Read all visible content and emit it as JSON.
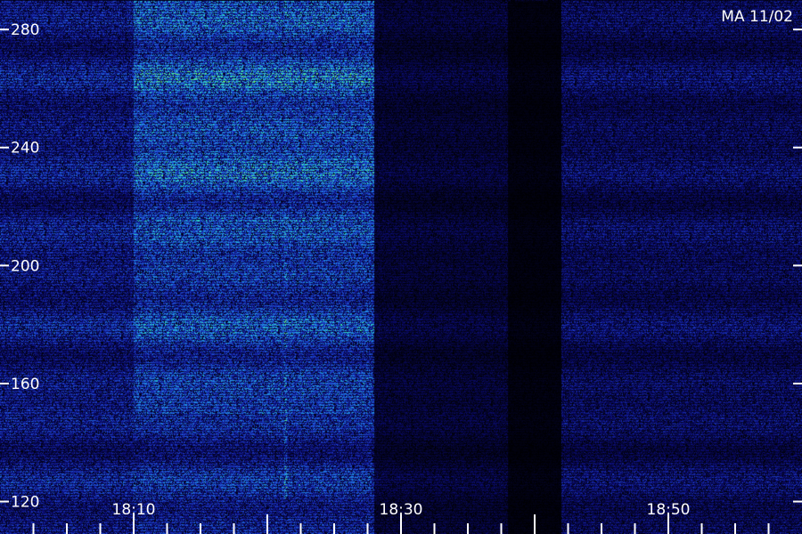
{
  "chart_data": {
    "type": "heatmap",
    "title": "",
    "corner_label": "MA 11/02",
    "xlabel": "",
    "ylabel": "",
    "x_ticks": [
      {
        "label": "18:10",
        "minutes": 10
      },
      {
        "label": "18:30",
        "minutes": 30
      },
      {
        "label": "18:50",
        "minutes": 50
      }
    ],
    "y_ticks": [
      {
        "label": "280",
        "value": 280
      },
      {
        "label": "240",
        "value": 240
      },
      {
        "label": "200",
        "value": 200
      },
      {
        "label": "160",
        "value": 160
      },
      {
        "label": "120",
        "value": 120
      }
    ],
    "xlim_minutes": [
      0,
      60
    ],
    "ylim": [
      109,
      290
    ],
    "colormap": [
      "#000000",
      "#0a0a6e",
      "#1e3fcf",
      "#1f8fe6",
      "#2fe0c8",
      "#8cff3a"
    ],
    "intensity_regions": [
      {
        "t_start": 0,
        "t_end": 10,
        "v_low": 109,
        "v_high": 290,
        "level": 0.42
      },
      {
        "t_start": 10,
        "t_end": 28,
        "v_low": 109,
        "v_high": 150,
        "level": 0.5
      },
      {
        "t_start": 10,
        "t_end": 28,
        "v_low": 150,
        "v_high": 215,
        "level": 0.62
      },
      {
        "t_start": 10,
        "t_end": 28,
        "v_low": 215,
        "v_high": 290,
        "level": 0.72
      },
      {
        "t_start": 28,
        "t_end": 38,
        "v_low": 109,
        "v_high": 290,
        "level": 0.18
      },
      {
        "t_start": 38,
        "t_end": 42,
        "v_low": 109,
        "v_high": 290,
        "level": 0.05
      },
      {
        "t_start": 42,
        "t_end": 60,
        "v_low": 109,
        "v_high": 290,
        "level": 0.3
      }
    ],
    "vertical_lines": [
      {
        "minutes": 21.3,
        "level": 0.85
      }
    ]
  }
}
